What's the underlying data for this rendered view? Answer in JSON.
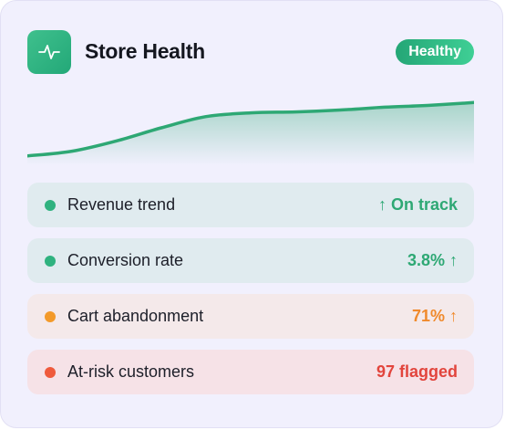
{
  "card": {
    "title": "Store Health",
    "status_badge": "Healthy",
    "icon": "activity-pulse-icon"
  },
  "colors": {
    "green": "#2ea874",
    "orange": "#f08a2c",
    "red": "#e2453d",
    "accent": "#2fb27f"
  },
  "metrics": [
    {
      "label": "Revenue trend",
      "value": "↑ On track",
      "status": "green"
    },
    {
      "label": "Conversion rate",
      "value": "3.8% ↑",
      "status": "green"
    },
    {
      "label": "Cart abandonment",
      "value": "71% ↑",
      "status": "orange"
    },
    {
      "label": "At-risk customers",
      "value": "97 flagged",
      "status": "red"
    }
  ],
  "chart_data": {
    "type": "area",
    "x": [
      0,
      1,
      2,
      3,
      4,
      5,
      6,
      7,
      8,
      9,
      10
    ],
    "values": [
      10,
      15,
      26,
      40,
      52,
      56,
      57,
      59,
      62,
      64,
      67
    ],
    "ylim": [
      0,
      80
    ],
    "grid": false,
    "axes": false
  }
}
